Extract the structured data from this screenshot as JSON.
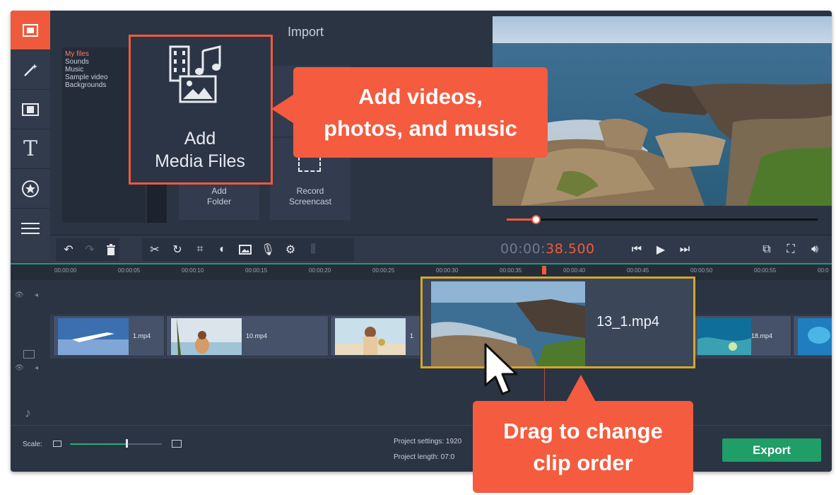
{
  "import": {
    "title": "Import",
    "file_items": [
      "My files",
      "Sounds",
      "Music",
      "Sample video",
      "Backgrounds"
    ],
    "add_media_label_line1": "Add",
    "add_media_label_line2": "Media Files",
    "add_folder_line1": "Add",
    "add_folder_line2": "Folder",
    "record_line1": "Record",
    "record_line2": "Screencast",
    "record_partial": "Re"
  },
  "toolbar": {
    "timecode_prefix": "00:00:",
    "timecode_accent": "38.500"
  },
  "ruler": {
    "ticks": [
      "00:00:00",
      "00:00:05",
      "00:00:10",
      "00:00:15",
      "00:00:20",
      "00:00:25",
      "00:00:30",
      "00:00:35",
      "00:00:40",
      "00:00:45",
      "00:00:50",
      "00:00:55",
      "00:0"
    ]
  },
  "clips": [
    {
      "name": "1.mp4"
    },
    {
      "name": "10.mp4"
    },
    {
      "name": "1"
    },
    {
      "name": "13_1.mp4"
    },
    {
      "name": "18.mp4"
    }
  ],
  "bottom": {
    "scale_label": "Scale:",
    "project_settings": "Project settings: 1920",
    "project_length": "Project length:   07:0",
    "export_label": "Export"
  },
  "callouts": {
    "add_videos_line1": "Add videos,",
    "add_videos_line2": "photos, and music",
    "drag_line1": "Drag to change",
    "drag_line2": "clip order"
  },
  "colors": {
    "accent": "#f05a3c",
    "export": "#1f9e67",
    "drag_border": "#d4a62b"
  }
}
